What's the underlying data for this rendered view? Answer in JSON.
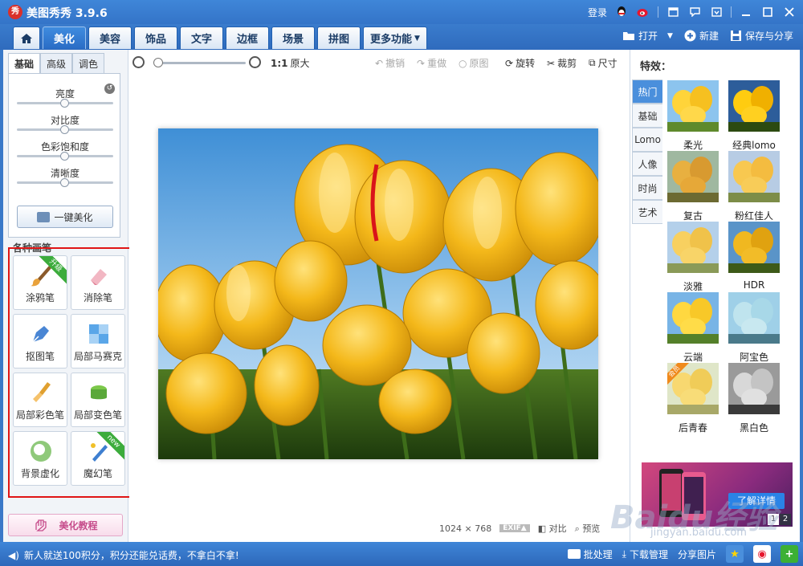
{
  "app": {
    "logo_text": "秀",
    "title": "美图秀秀 3.9.6"
  },
  "titlebar": {
    "login": "登录",
    "icons": [
      "qq-icon",
      "weibo-icon",
      "skin-icon",
      "message-icon",
      "menu-icon",
      "minimize-icon",
      "maximize-icon",
      "close-icon"
    ]
  },
  "nav": {
    "tabs": [
      "美化",
      "美容",
      "饰品",
      "文字",
      "边框",
      "场景",
      "拼图",
      "更多功能"
    ],
    "active_tab": "美化",
    "open": "打开",
    "new": "新建",
    "save_share": "保存与分享"
  },
  "left": {
    "subtabs": [
      "基础",
      "高级",
      "调色"
    ],
    "sliders": [
      {
        "label": "亮度",
        "value": 0.5
      },
      {
        "label": "对比度",
        "value": 0.5
      },
      {
        "label": "色彩饱和度",
        "value": 0.5
      },
      {
        "label": "清晰度",
        "value": 0.5
      }
    ],
    "one_click": "一键美化",
    "brush_title": "各种画笔",
    "brushes": [
      {
        "label": "涂鸦笔",
        "badge": "升级"
      },
      {
        "label": "消除笔",
        "badge": ""
      },
      {
        "label": "抠图笔",
        "badge": ""
      },
      {
        "label": "局部马赛克",
        "badge": ""
      },
      {
        "label": "局部彩色笔",
        "badge": ""
      },
      {
        "label": "局部变色笔",
        "badge": ""
      },
      {
        "label": "背景虚化",
        "badge": ""
      },
      {
        "label": "魔幻笔",
        "badge": "new"
      }
    ],
    "tutorial": "美化教程"
  },
  "toolbar": {
    "ratio": "1:1",
    "original_size": "原大",
    "undo": "撤销",
    "redo": "重做",
    "original": "原图",
    "rotate": "旋转",
    "crop": "裁剪",
    "resize": "尺寸",
    "zoom": 0.02
  },
  "image_info": {
    "width": "1024",
    "x": "×",
    "height": "768",
    "exif": "EXIF▲",
    "compare": "对比",
    "preview": "预览"
  },
  "effects": {
    "title": "特效：",
    "categories": [
      "热门",
      "基础",
      "Lomo",
      "人像",
      "时尚",
      "艺术"
    ],
    "active_category": "热门",
    "items": [
      {
        "label": "柔光",
        "badge": ""
      },
      {
        "label": "经典lomo",
        "badge": ""
      },
      {
        "label": "复古",
        "badge": ""
      },
      {
        "label": "粉红佳人",
        "badge": ""
      },
      {
        "label": "淡雅",
        "badge": ""
      },
      {
        "label": "HDR",
        "badge": ""
      },
      {
        "label": "云端",
        "badge": ""
      },
      {
        "label": "阿宝色",
        "badge": ""
      },
      {
        "label": "后青春",
        "badge": "会员"
      },
      {
        "label": "黑白色",
        "badge": ""
      }
    ],
    "ad_button": "了解详情",
    "ad_pages": [
      "1",
      "2"
    ]
  },
  "status": {
    "message": "新人就送100积分，积分还能兑话费，不拿白不拿!",
    "batch": "批处理",
    "download": "下载管理",
    "share": "分享图片"
  },
  "watermark": {
    "main": "Baidu经验",
    "sub": "jingyan.baidu.com"
  },
  "colors": {
    "accent": "#3a79c8",
    "highlight_border": "#e01515",
    "ribbon_green": "#3cac3c"
  }
}
